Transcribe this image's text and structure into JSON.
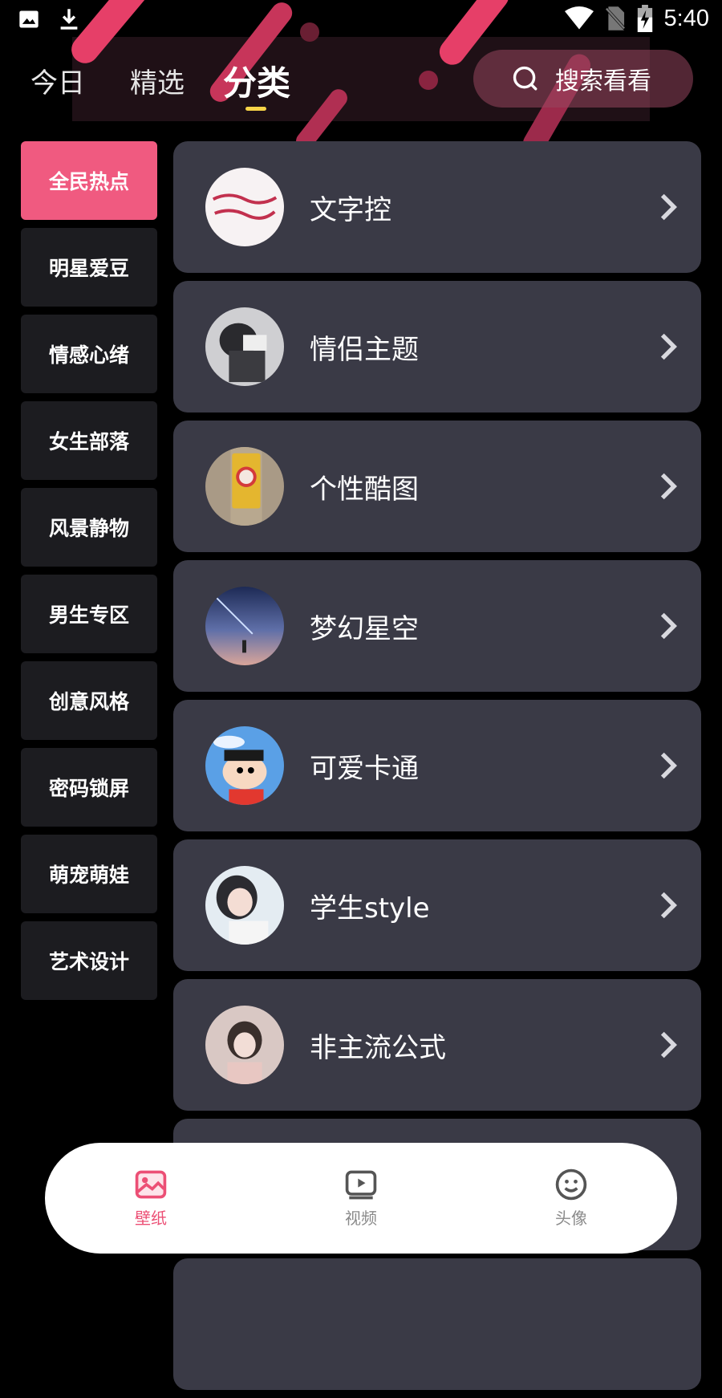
{
  "status_bar": {
    "time": "5:40",
    "left_icons": [
      "image-icon",
      "download-icon"
    ],
    "right_icons": [
      "wifi-icon",
      "no-sim-icon",
      "battery-charging-icon"
    ]
  },
  "top_nav": {
    "tabs": [
      {
        "label": "今日",
        "active": false
      },
      {
        "label": "精选",
        "active": false
      },
      {
        "label": "分类",
        "active": true
      }
    ],
    "search_placeholder": "搜索看看",
    "accent_color": "#f7d448"
  },
  "sidebar": {
    "active_color": "#f05a80",
    "items": [
      {
        "label": "全民热点",
        "active": true
      },
      {
        "label": "明星爱豆",
        "active": false
      },
      {
        "label": "情感心绪",
        "active": false
      },
      {
        "label": "女生部落",
        "active": false
      },
      {
        "label": "风景静物",
        "active": false
      },
      {
        "label": "男生专区",
        "active": false
      },
      {
        "label": "创意风格",
        "active": false
      },
      {
        "label": "密码锁屏",
        "active": false
      },
      {
        "label": "萌宠萌娃",
        "active": false
      },
      {
        "label": "艺术设计",
        "active": false
      }
    ]
  },
  "categories": [
    {
      "label": "文字控"
    },
    {
      "label": "情侣主题"
    },
    {
      "label": "个性酷图"
    },
    {
      "label": "梦幻星空"
    },
    {
      "label": "可爱卡通"
    },
    {
      "label": "学生style"
    },
    {
      "label": "非主流公式"
    }
  ],
  "bottom_nav": {
    "items": [
      {
        "label": "壁纸",
        "icon": "wallpaper-icon",
        "active": true
      },
      {
        "label": "视频",
        "icon": "video-icon",
        "active": false
      },
      {
        "label": "头像",
        "icon": "avatar-smile-icon",
        "active": false
      }
    ],
    "active_color": "#ec4f75"
  }
}
